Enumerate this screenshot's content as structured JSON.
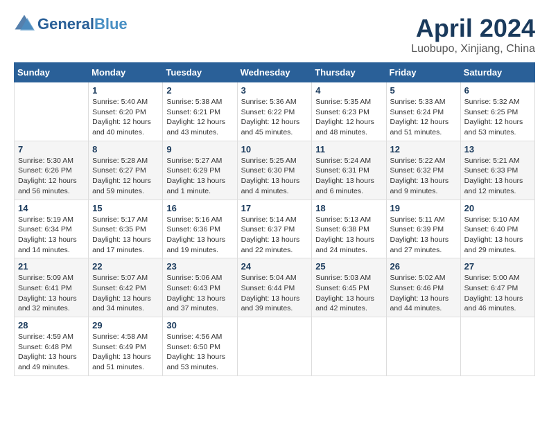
{
  "header": {
    "logo_line1": "General",
    "logo_line2": "Blue",
    "month": "April 2024",
    "location": "Luobupo, Xinjiang, China"
  },
  "weekdays": [
    "Sunday",
    "Monday",
    "Tuesday",
    "Wednesday",
    "Thursday",
    "Friday",
    "Saturday"
  ],
  "weeks": [
    [
      {
        "day": "",
        "sunrise": "",
        "sunset": "",
        "daylight": ""
      },
      {
        "day": "1",
        "sunrise": "Sunrise: 5:40 AM",
        "sunset": "Sunset: 6:20 PM",
        "daylight": "Daylight: 12 hours and 40 minutes."
      },
      {
        "day": "2",
        "sunrise": "Sunrise: 5:38 AM",
        "sunset": "Sunset: 6:21 PM",
        "daylight": "Daylight: 12 hours and 43 minutes."
      },
      {
        "day": "3",
        "sunrise": "Sunrise: 5:36 AM",
        "sunset": "Sunset: 6:22 PM",
        "daylight": "Daylight: 12 hours and 45 minutes."
      },
      {
        "day": "4",
        "sunrise": "Sunrise: 5:35 AM",
        "sunset": "Sunset: 6:23 PM",
        "daylight": "Daylight: 12 hours and 48 minutes."
      },
      {
        "day": "5",
        "sunrise": "Sunrise: 5:33 AM",
        "sunset": "Sunset: 6:24 PM",
        "daylight": "Daylight: 12 hours and 51 minutes."
      },
      {
        "day": "6",
        "sunrise": "Sunrise: 5:32 AM",
        "sunset": "Sunset: 6:25 PM",
        "daylight": "Daylight: 12 hours and 53 minutes."
      }
    ],
    [
      {
        "day": "7",
        "sunrise": "Sunrise: 5:30 AM",
        "sunset": "Sunset: 6:26 PM",
        "daylight": "Daylight: 12 hours and 56 minutes."
      },
      {
        "day": "8",
        "sunrise": "Sunrise: 5:28 AM",
        "sunset": "Sunset: 6:27 PM",
        "daylight": "Daylight: 12 hours and 59 minutes."
      },
      {
        "day": "9",
        "sunrise": "Sunrise: 5:27 AM",
        "sunset": "Sunset: 6:29 PM",
        "daylight": "Daylight: 13 hours and 1 minute."
      },
      {
        "day": "10",
        "sunrise": "Sunrise: 5:25 AM",
        "sunset": "Sunset: 6:30 PM",
        "daylight": "Daylight: 13 hours and 4 minutes."
      },
      {
        "day": "11",
        "sunrise": "Sunrise: 5:24 AM",
        "sunset": "Sunset: 6:31 PM",
        "daylight": "Daylight: 13 hours and 6 minutes."
      },
      {
        "day": "12",
        "sunrise": "Sunrise: 5:22 AM",
        "sunset": "Sunset: 6:32 PM",
        "daylight": "Daylight: 13 hours and 9 minutes."
      },
      {
        "day": "13",
        "sunrise": "Sunrise: 5:21 AM",
        "sunset": "Sunset: 6:33 PM",
        "daylight": "Daylight: 13 hours and 12 minutes."
      }
    ],
    [
      {
        "day": "14",
        "sunrise": "Sunrise: 5:19 AM",
        "sunset": "Sunset: 6:34 PM",
        "daylight": "Daylight: 13 hours and 14 minutes."
      },
      {
        "day": "15",
        "sunrise": "Sunrise: 5:17 AM",
        "sunset": "Sunset: 6:35 PM",
        "daylight": "Daylight: 13 hours and 17 minutes."
      },
      {
        "day": "16",
        "sunrise": "Sunrise: 5:16 AM",
        "sunset": "Sunset: 6:36 PM",
        "daylight": "Daylight: 13 hours and 19 minutes."
      },
      {
        "day": "17",
        "sunrise": "Sunrise: 5:14 AM",
        "sunset": "Sunset: 6:37 PM",
        "daylight": "Daylight: 13 hours and 22 minutes."
      },
      {
        "day": "18",
        "sunrise": "Sunrise: 5:13 AM",
        "sunset": "Sunset: 6:38 PM",
        "daylight": "Daylight: 13 hours and 24 minutes."
      },
      {
        "day": "19",
        "sunrise": "Sunrise: 5:11 AM",
        "sunset": "Sunset: 6:39 PM",
        "daylight": "Daylight: 13 hours and 27 minutes."
      },
      {
        "day": "20",
        "sunrise": "Sunrise: 5:10 AM",
        "sunset": "Sunset: 6:40 PM",
        "daylight": "Daylight: 13 hours and 29 minutes."
      }
    ],
    [
      {
        "day": "21",
        "sunrise": "Sunrise: 5:09 AM",
        "sunset": "Sunset: 6:41 PM",
        "daylight": "Daylight: 13 hours and 32 minutes."
      },
      {
        "day": "22",
        "sunrise": "Sunrise: 5:07 AM",
        "sunset": "Sunset: 6:42 PM",
        "daylight": "Daylight: 13 hours and 34 minutes."
      },
      {
        "day": "23",
        "sunrise": "Sunrise: 5:06 AM",
        "sunset": "Sunset: 6:43 PM",
        "daylight": "Daylight: 13 hours and 37 minutes."
      },
      {
        "day": "24",
        "sunrise": "Sunrise: 5:04 AM",
        "sunset": "Sunset: 6:44 PM",
        "daylight": "Daylight: 13 hours and 39 minutes."
      },
      {
        "day": "25",
        "sunrise": "Sunrise: 5:03 AM",
        "sunset": "Sunset: 6:45 PM",
        "daylight": "Daylight: 13 hours and 42 minutes."
      },
      {
        "day": "26",
        "sunrise": "Sunrise: 5:02 AM",
        "sunset": "Sunset: 6:46 PM",
        "daylight": "Daylight: 13 hours and 44 minutes."
      },
      {
        "day": "27",
        "sunrise": "Sunrise: 5:00 AM",
        "sunset": "Sunset: 6:47 PM",
        "daylight": "Daylight: 13 hours and 46 minutes."
      }
    ],
    [
      {
        "day": "28",
        "sunrise": "Sunrise: 4:59 AM",
        "sunset": "Sunset: 6:48 PM",
        "daylight": "Daylight: 13 hours and 49 minutes."
      },
      {
        "day": "29",
        "sunrise": "Sunrise: 4:58 AM",
        "sunset": "Sunset: 6:49 PM",
        "daylight": "Daylight: 13 hours and 51 minutes."
      },
      {
        "day": "30",
        "sunrise": "Sunrise: 4:56 AM",
        "sunset": "Sunset: 6:50 PM",
        "daylight": "Daylight: 13 hours and 53 minutes."
      },
      {
        "day": "",
        "sunrise": "",
        "sunset": "",
        "daylight": ""
      },
      {
        "day": "",
        "sunrise": "",
        "sunset": "",
        "daylight": ""
      },
      {
        "day": "",
        "sunrise": "",
        "sunset": "",
        "daylight": ""
      },
      {
        "day": "",
        "sunrise": "",
        "sunset": "",
        "daylight": ""
      }
    ]
  ]
}
